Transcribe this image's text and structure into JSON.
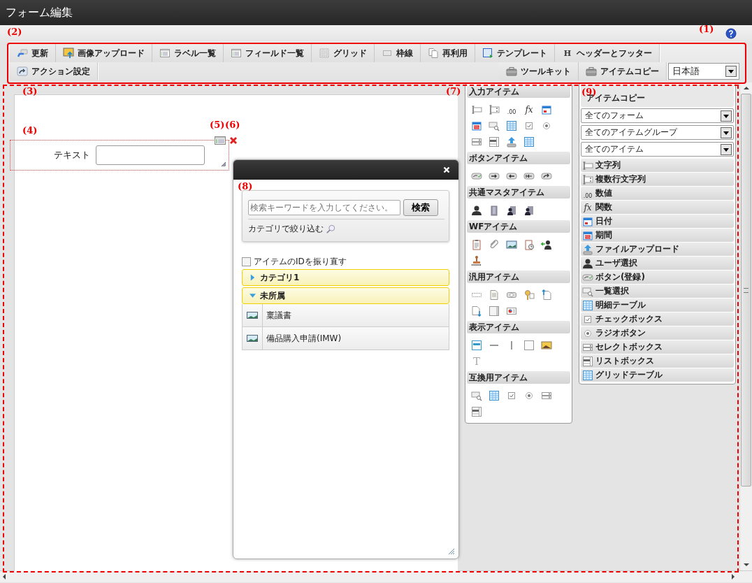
{
  "window": {
    "title": "フォーム編集"
  },
  "annotations": [
    {
      "label": "(1)"
    },
    {
      "label": "(2)"
    },
    {
      "label": "(3)"
    },
    {
      "label": "(4)"
    },
    {
      "label": "(5)"
    },
    {
      "label": "(6)"
    },
    {
      "label": "(7)"
    },
    {
      "label": "(8)"
    },
    {
      "label": "(9)"
    }
  ],
  "toolbar": {
    "tabs": [
      {
        "label": "更新",
        "kind": "update"
      },
      {
        "label": "画像アップロード",
        "kind": "image-upload"
      },
      {
        "label": "ラベル一覧",
        "kind": "list"
      },
      {
        "label": "フィールド一覧",
        "kind": "list"
      },
      {
        "label": "グリッド",
        "kind": "grid"
      },
      {
        "label": "枠線",
        "kind": "border"
      },
      {
        "label": "再利用",
        "kind": "reuse"
      },
      {
        "label": "テンプレート",
        "kind": "template"
      },
      {
        "label": "ヘッダーとフッター",
        "kind": "header",
        "glyph": "H"
      }
    ],
    "second_row": [
      {
        "label": "アクション設定",
        "kind": "action"
      }
    ],
    "right_tabs": [
      {
        "label": "ツールキット",
        "kind": "toolkit"
      },
      {
        "label": "アイテムコピー",
        "kind": "toolkit"
      }
    ],
    "language": {
      "value": "日本語"
    }
  },
  "canvas": {
    "field": {
      "label": "テキスト"
    }
  },
  "palette": [
    {
      "title": "入力アイテム",
      "items": [
        {
          "kind": "string"
        },
        {
          "kind": "multiline"
        },
        {
          "kind": "number",
          "glyph": ".00"
        },
        {
          "kind": "function",
          "glyph": "fx"
        },
        {
          "kind": "date"
        },
        {
          "kind": "period"
        },
        {
          "kind": "lookup"
        },
        {
          "kind": "table"
        },
        {
          "kind": "checkbox"
        },
        {
          "kind": "radio"
        },
        {
          "kind": "select"
        },
        {
          "kind": "listbox"
        },
        {
          "kind": "upload"
        },
        {
          "kind": "table"
        }
      ]
    },
    {
      "title": "ボタンアイテム",
      "items": [
        {
          "kind": "btn-register"
        },
        {
          "kind": "btn-next"
        },
        {
          "kind": "btn-back"
        },
        {
          "kind": "btn-return"
        },
        {
          "kind": "btn-share"
        }
      ]
    },
    {
      "title": "共通マスタアイテム",
      "items": [
        {
          "kind": "user"
        },
        {
          "kind": "org"
        },
        {
          "kind": "user-org"
        },
        {
          "kind": "user-org"
        }
      ]
    },
    {
      "title": "WFアイテム",
      "items": [
        {
          "kind": "clipboard"
        },
        {
          "kind": "attach"
        },
        {
          "kind": "image"
        },
        {
          "kind": "history"
        },
        {
          "kind": "proxy"
        },
        {
          "kind": "stamp"
        }
      ]
    },
    {
      "title": "汎用アイテム",
      "items": [
        {
          "kind": "space"
        },
        {
          "kind": "doc"
        },
        {
          "kind": "gearbox"
        },
        {
          "kind": "key"
        },
        {
          "kind": "doc-up"
        },
        {
          "kind": "doc-down"
        },
        {
          "kind": "panel"
        },
        {
          "kind": "chart"
        }
      ]
    },
    {
      "title": "表示アイテム",
      "items": [
        {
          "kind": "label"
        },
        {
          "kind": "hline"
        },
        {
          "kind": "vline"
        },
        {
          "kind": "frame"
        },
        {
          "kind": "photo"
        },
        {
          "kind": "text",
          "glyph": "T"
        }
      ]
    },
    {
      "title": "互換用アイテム",
      "items": [
        {
          "kind": "lookup"
        },
        {
          "kind": "table"
        },
        {
          "kind": "checkbox"
        },
        {
          "kind": "radio"
        },
        {
          "kind": "select"
        },
        {
          "kind": "listbox"
        }
      ]
    }
  ],
  "dialog": {
    "search_placeholder": "検索キーワードを入力してください。",
    "search_button": "検索",
    "filter_label": "カテゴリで絞り込む",
    "renumber": {
      "label": "アイテムのIDを振り直す",
      "checked": false
    },
    "categories": [
      {
        "label": "カテゴリ1",
        "expanded": false
      },
      {
        "label": "未所属",
        "expanded": true,
        "children": [
          {
            "label": "稟議書"
          },
          {
            "label": "備品購入申請(IMW)"
          }
        ]
      }
    ]
  },
  "item_copy": {
    "title": "アイテムコピー",
    "filters": [
      {
        "value": "全てのフォーム"
      },
      {
        "value": "全てのアイテムグループ"
      },
      {
        "value": "全てのアイテム"
      }
    ],
    "items": [
      {
        "kind": "string",
        "label": "文字列"
      },
      {
        "kind": "multiline",
        "label": "複数行文字列"
      },
      {
        "kind": "number",
        "glyph": ".00",
        "label": "数値"
      },
      {
        "kind": "function",
        "glyph": "fx",
        "label": "関数"
      },
      {
        "kind": "date",
        "label": "日付"
      },
      {
        "kind": "period",
        "label": "期間"
      },
      {
        "kind": "upload",
        "label": "ファイルアップロード"
      },
      {
        "kind": "user",
        "label": "ユーザ選択"
      },
      {
        "kind": "btn-register",
        "label": "ボタン(登録)"
      },
      {
        "kind": "lookup",
        "label": "一覧選択"
      },
      {
        "kind": "table",
        "label": "明細テーブル"
      },
      {
        "kind": "checkbox",
        "label": "チェックボックス"
      },
      {
        "kind": "radio",
        "label": "ラジオボタン"
      },
      {
        "kind": "select",
        "label": "セレクトボックス"
      },
      {
        "kind": "listbox",
        "label": "リストボックス"
      },
      {
        "kind": "table",
        "label": "グリッドテーブル"
      }
    ]
  }
}
